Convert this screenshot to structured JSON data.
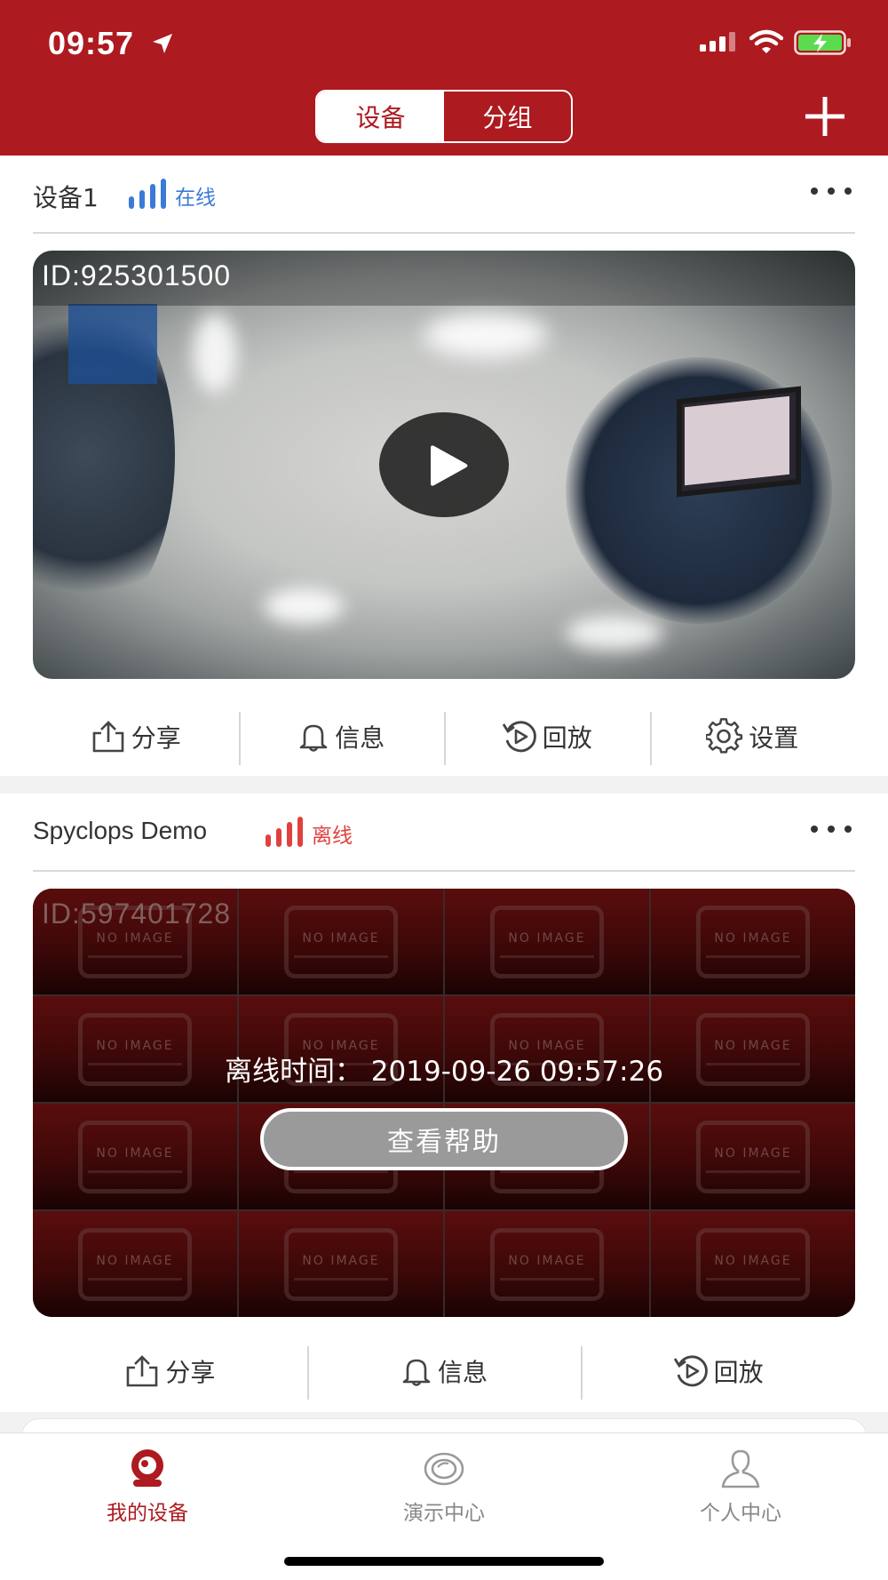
{
  "status_bar": {
    "time": "09:57",
    "icons": [
      "location-arrow-icon",
      "cellular-signal-icon",
      "wifi-icon",
      "battery-charging-icon"
    ]
  },
  "header": {
    "segments": [
      {
        "label": "设备",
        "active": true
      },
      {
        "label": "分组",
        "active": false
      }
    ],
    "add_icon": "plus-icon"
  },
  "devices": [
    {
      "name": "设备1",
      "status": "在线",
      "status_color": "#3a7bd5",
      "id_label": "ID:925301500",
      "menu_icon": "more-dots-icon",
      "actions": [
        {
          "icon": "share-icon",
          "label": "分享"
        },
        {
          "icon": "bell-icon",
          "label": "信息"
        },
        {
          "icon": "playback-icon",
          "label": "回放"
        },
        {
          "icon": "gear-icon",
          "label": "设置"
        }
      ]
    },
    {
      "name": "Spyclops Demo",
      "status": "离线",
      "status_color": "#e0413e",
      "id_label": "ID:597401728",
      "placeholder_text": "NO IMAGE",
      "offline_time": "离线时间：  2019-09-26 09:57:26",
      "help_label": "查看帮助",
      "menu_icon": "more-dots-icon",
      "actions": [
        {
          "icon": "share-icon",
          "label": "分享"
        },
        {
          "icon": "bell-icon",
          "label": "信息"
        },
        {
          "icon": "playback-icon",
          "label": "回放"
        }
      ]
    }
  ],
  "tabbar": {
    "tabs": [
      {
        "label": "我的设备",
        "icon": "camera-icon",
        "active": true
      },
      {
        "label": "演示中心",
        "icon": "demo-eye-icon",
        "active": false
      },
      {
        "label": "个人中心",
        "icon": "person-icon",
        "active": false
      }
    ]
  },
  "colors": {
    "brand": "#ad1a1f",
    "online": "#3a7bd5",
    "offline": "#e0413e"
  }
}
